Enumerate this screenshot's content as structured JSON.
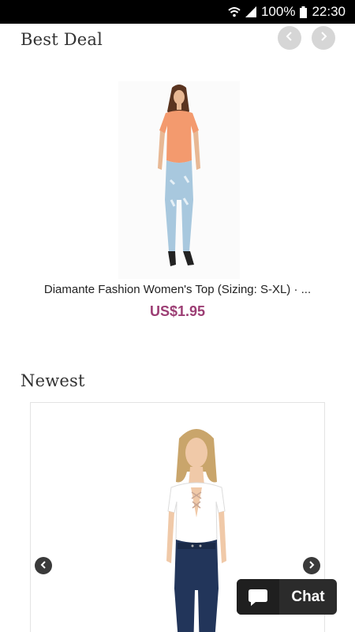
{
  "status_bar": {
    "battery": "100%",
    "time": "22:30",
    "icons": [
      "wifi-icon",
      "signal-icon",
      "battery-icon"
    ]
  },
  "best_deal": {
    "title": "Best Deal",
    "product": {
      "name": "Diamante Fashion Women's Top (Sizing: S-XL) · ...",
      "price": "US$1.95",
      "price_color": "#9c3e74"
    }
  },
  "newest": {
    "title": "Newest"
  },
  "chat": {
    "label": "Chat"
  }
}
